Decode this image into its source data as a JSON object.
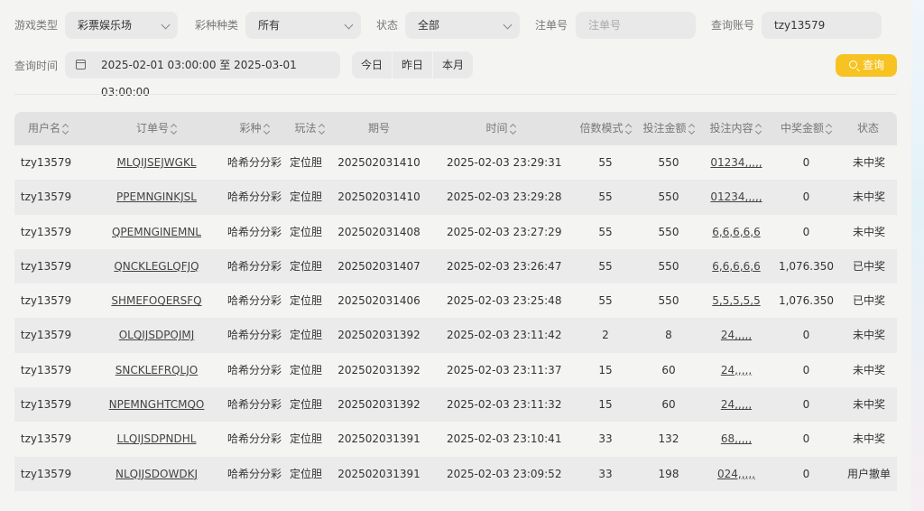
{
  "filters": {
    "game_type_label": "游戏类型",
    "game_type_value": "彩票娱乐场",
    "lottery_kind_label": "彩种种类",
    "lottery_kind_value": "所有",
    "status_label": "状态",
    "status_value": "全部",
    "order_no_label": "注单号",
    "order_no_placeholder": "注单号",
    "account_label": "查询账号",
    "account_value": "tzy13579",
    "time_label": "查询时间",
    "time_range": "2025-02-01 03:00:00 至 2025-03-01 03:00:00",
    "today": "今日",
    "yesterday": "昨日",
    "this_month": "本月",
    "search": "查询"
  },
  "table": {
    "headers": {
      "user": "用户名",
      "order": "订单号",
      "kind": "彩种",
      "play": "玩法",
      "period": "期号",
      "time": "时间",
      "multiple": "倍数模式",
      "bet_amount": "投注金额",
      "bet_content": "投注内容",
      "win_amount": "中奖金额",
      "status": "状态"
    },
    "rows": [
      {
        "user": "tzy13579",
        "order": "MLQIJSEJWGKL",
        "kind": "哈希分分彩",
        "play": "定位胆",
        "period": "202502031410",
        "time": "2025-02-03 23:29:31",
        "multiple": "55",
        "bet": "550",
        "content": "01234,,,,,",
        "win": "0",
        "status": "未中奖"
      },
      {
        "user": "tzy13579",
        "order": "PPEMNGINKJSL",
        "kind": "哈希分分彩",
        "play": "定位胆",
        "period": "202502031410",
        "time": "2025-02-03 23:29:28",
        "multiple": "55",
        "bet": "550",
        "content": "01234,,,,,",
        "win": "0",
        "status": "未中奖"
      },
      {
        "user": "tzy13579",
        "order": "QPEMNGINEMNL",
        "kind": "哈希分分彩",
        "play": "定位胆",
        "period": "202502031408",
        "time": "2025-02-03 23:27:29",
        "multiple": "55",
        "bet": "550",
        "content": "6,6,6,6,6",
        "win": "0",
        "status": "未中奖"
      },
      {
        "user": "tzy13579",
        "order": "QNCKLEGLQFJQ",
        "kind": "哈希分分彩",
        "play": "定位胆",
        "period": "202502031407",
        "time": "2025-02-03 23:26:47",
        "multiple": "55",
        "bet": "550",
        "content": "6,6,6,6,6",
        "win": "1,076.350",
        "status": "已中奖"
      },
      {
        "user": "tzy13579",
        "order": "SHMEFOQERSFQ",
        "kind": "哈希分分彩",
        "play": "定位胆",
        "period": "202502031406",
        "time": "2025-02-03 23:25:48",
        "multiple": "55",
        "bet": "550",
        "content": "5,5,5,5,5",
        "win": "1,076.350",
        "status": "已中奖"
      },
      {
        "user": "tzy13579",
        "order": "OLQIJSDPOJMJ",
        "kind": "哈希分分彩",
        "play": "定位胆",
        "period": "202502031392",
        "time": "2025-02-03 23:11:42",
        "multiple": "2",
        "bet": "8",
        "content": "24,,,,,",
        "win": "0",
        "status": "未中奖"
      },
      {
        "user": "tzy13579",
        "order": "SNCKLEFRQLJO",
        "kind": "哈希分分彩",
        "play": "定位胆",
        "period": "202502031392",
        "time": "2025-02-03 23:11:37",
        "multiple": "15",
        "bet": "60",
        "content": "24,,,,,",
        "win": "0",
        "status": "未中奖"
      },
      {
        "user": "tzy13579",
        "order": "NPEMNGHTCMQO",
        "kind": "哈希分分彩",
        "play": "定位胆",
        "period": "202502031392",
        "time": "2025-02-03 23:11:32",
        "multiple": "15",
        "bet": "60",
        "content": "24,,,,,",
        "win": "0",
        "status": "未中奖"
      },
      {
        "user": "tzy13579",
        "order": "LLQIJSDPNDHL",
        "kind": "哈希分分彩",
        "play": "定位胆",
        "period": "202502031391",
        "time": "2025-02-03 23:10:41",
        "multiple": "33",
        "bet": "132",
        "content": "68,,,,,",
        "win": "0",
        "status": "未中奖"
      },
      {
        "user": "tzy13579",
        "order": "NLQIJSDOWDKJ",
        "kind": "哈希分分彩",
        "play": "定位胆",
        "period": "202502031391",
        "time": "2025-02-03 23:09:52",
        "multiple": "33",
        "bet": "198",
        "content": "024,,,,,",
        "win": "0",
        "status": "用户撤单"
      }
    ]
  }
}
